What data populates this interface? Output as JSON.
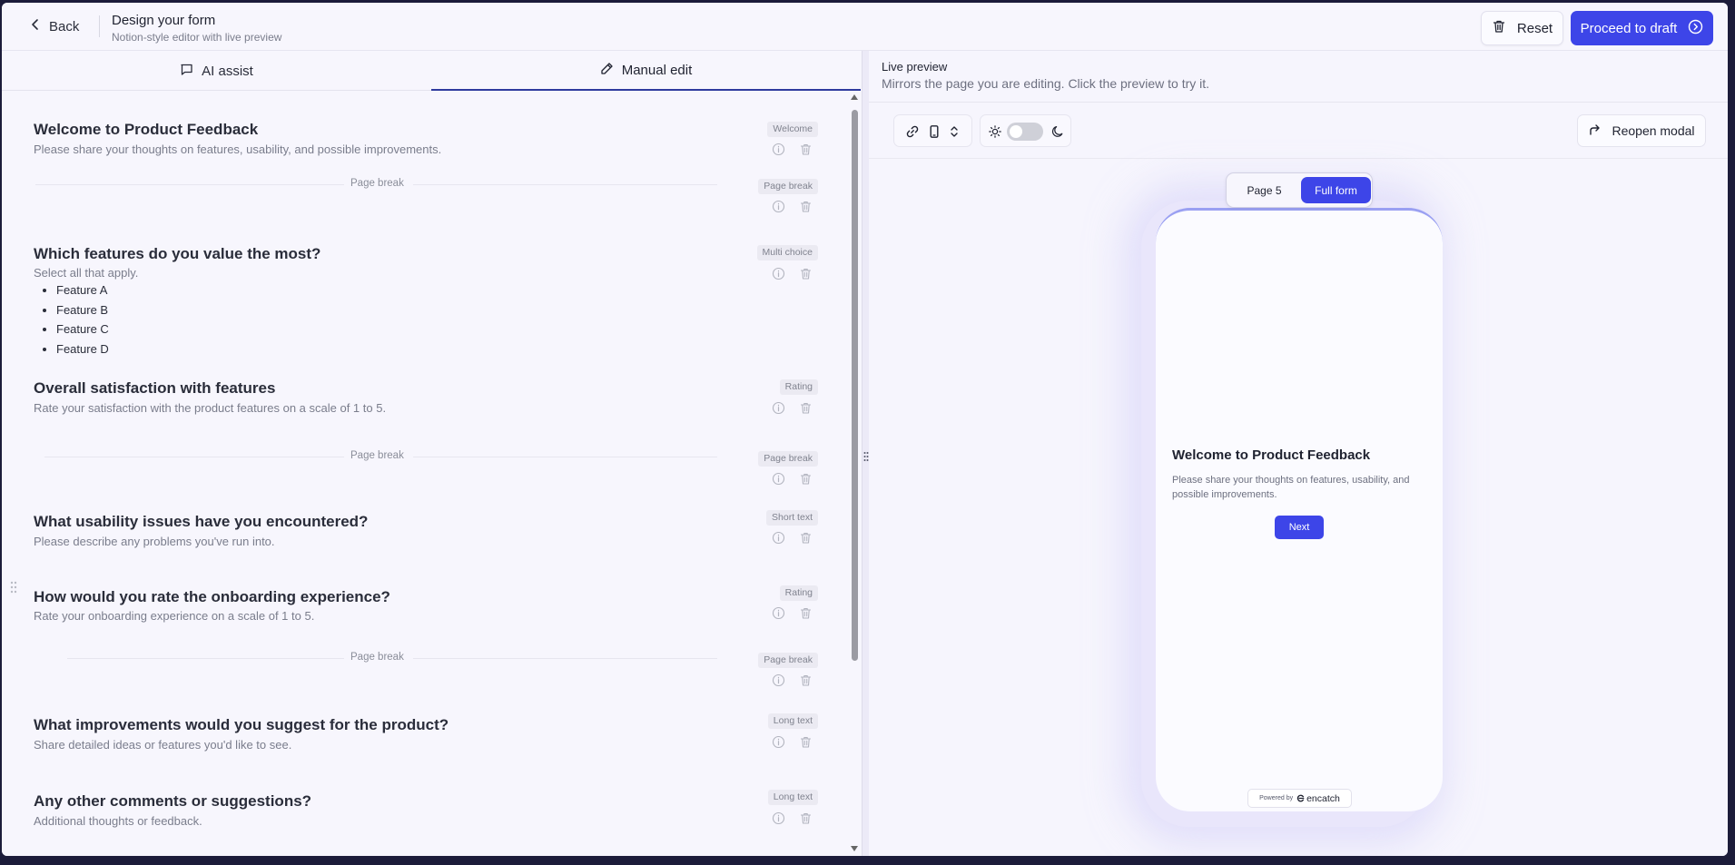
{
  "header": {
    "back_label": "Back",
    "title": "Design your form",
    "subtitle": "Notion-style editor with live preview",
    "reset_label": "Reset",
    "proceed_label": "Proceed to draft"
  },
  "tabs": {
    "ai_label": "AI assist",
    "manual_label": "Manual edit",
    "active": "Manual edit"
  },
  "blocks": [
    {
      "type": "question",
      "title": "Welcome to Product Feedback",
      "desc": "Please share your thoughts on features, usability, and possible improvements.",
      "tag": "Welcome"
    },
    {
      "type": "page_break",
      "label": "Page break",
      "tag": "Page break"
    },
    {
      "type": "question",
      "title": "Which features do you value the most?",
      "desc": "Select all that apply.",
      "tag": "Multi choice",
      "options": [
        "Feature A",
        "Feature B",
        "Feature C",
        "Feature D"
      ]
    },
    {
      "type": "question",
      "title": "Overall satisfaction with features",
      "desc": "Rate your satisfaction with the product features on a scale of 1 to 5.",
      "tag": "Rating"
    },
    {
      "type": "page_break",
      "label": "Page break",
      "tag": "Page break"
    },
    {
      "type": "question",
      "title": "What usability issues have you encountered?",
      "desc": "Please describe any problems you've run into.",
      "tag": "Short text"
    },
    {
      "type": "question",
      "title": "How would you rate the onboarding experience?",
      "desc": "Rate your onboarding experience on a scale of 1 to 5.",
      "tag": "Rating"
    },
    {
      "type": "page_break",
      "label": "Page break",
      "tag": "Page break"
    },
    {
      "type": "question",
      "title": "What improvements would you suggest for the product?",
      "desc": "Share detailed ideas or features you'd like to see.",
      "tag": "Long text"
    },
    {
      "type": "question",
      "title": "Any other comments or suggestions?",
      "desc": "Additional thoughts or feedback.",
      "tag": "Long text"
    }
  ],
  "preview": {
    "title": "Live preview",
    "subtitle": "Mirrors the page you are editing. Click the preview to try it.",
    "reopen_label": "Reopen modal",
    "page_label": "Page 5",
    "full_label": "Full form",
    "form_title": "Welcome to Product Feedback",
    "form_desc": "Please share your thoughts on features, usability, and possible improvements.",
    "next_label": "Next",
    "powered_by": "Powered by",
    "brand": "encatch",
    "theme_dark": false
  },
  "icons": {
    "back": "chevron-left-icon",
    "reset": "trash-icon",
    "proceed": "arrow-circle-right-icon",
    "ai": "chat-icon",
    "manual": "pencil-icon",
    "info": "info-icon",
    "delete": "trash-icon",
    "link": "link-icon",
    "device": "mobile-icon",
    "selector": "chevron-updown-icon",
    "sun": "sun-icon",
    "moon": "moon-icon",
    "reopen": "arrow-up-right-icon"
  },
  "colors": {
    "accent": "#3d45e8",
    "background": "#f6f5fd",
    "tab_underline": "#2e3a9e"
  }
}
